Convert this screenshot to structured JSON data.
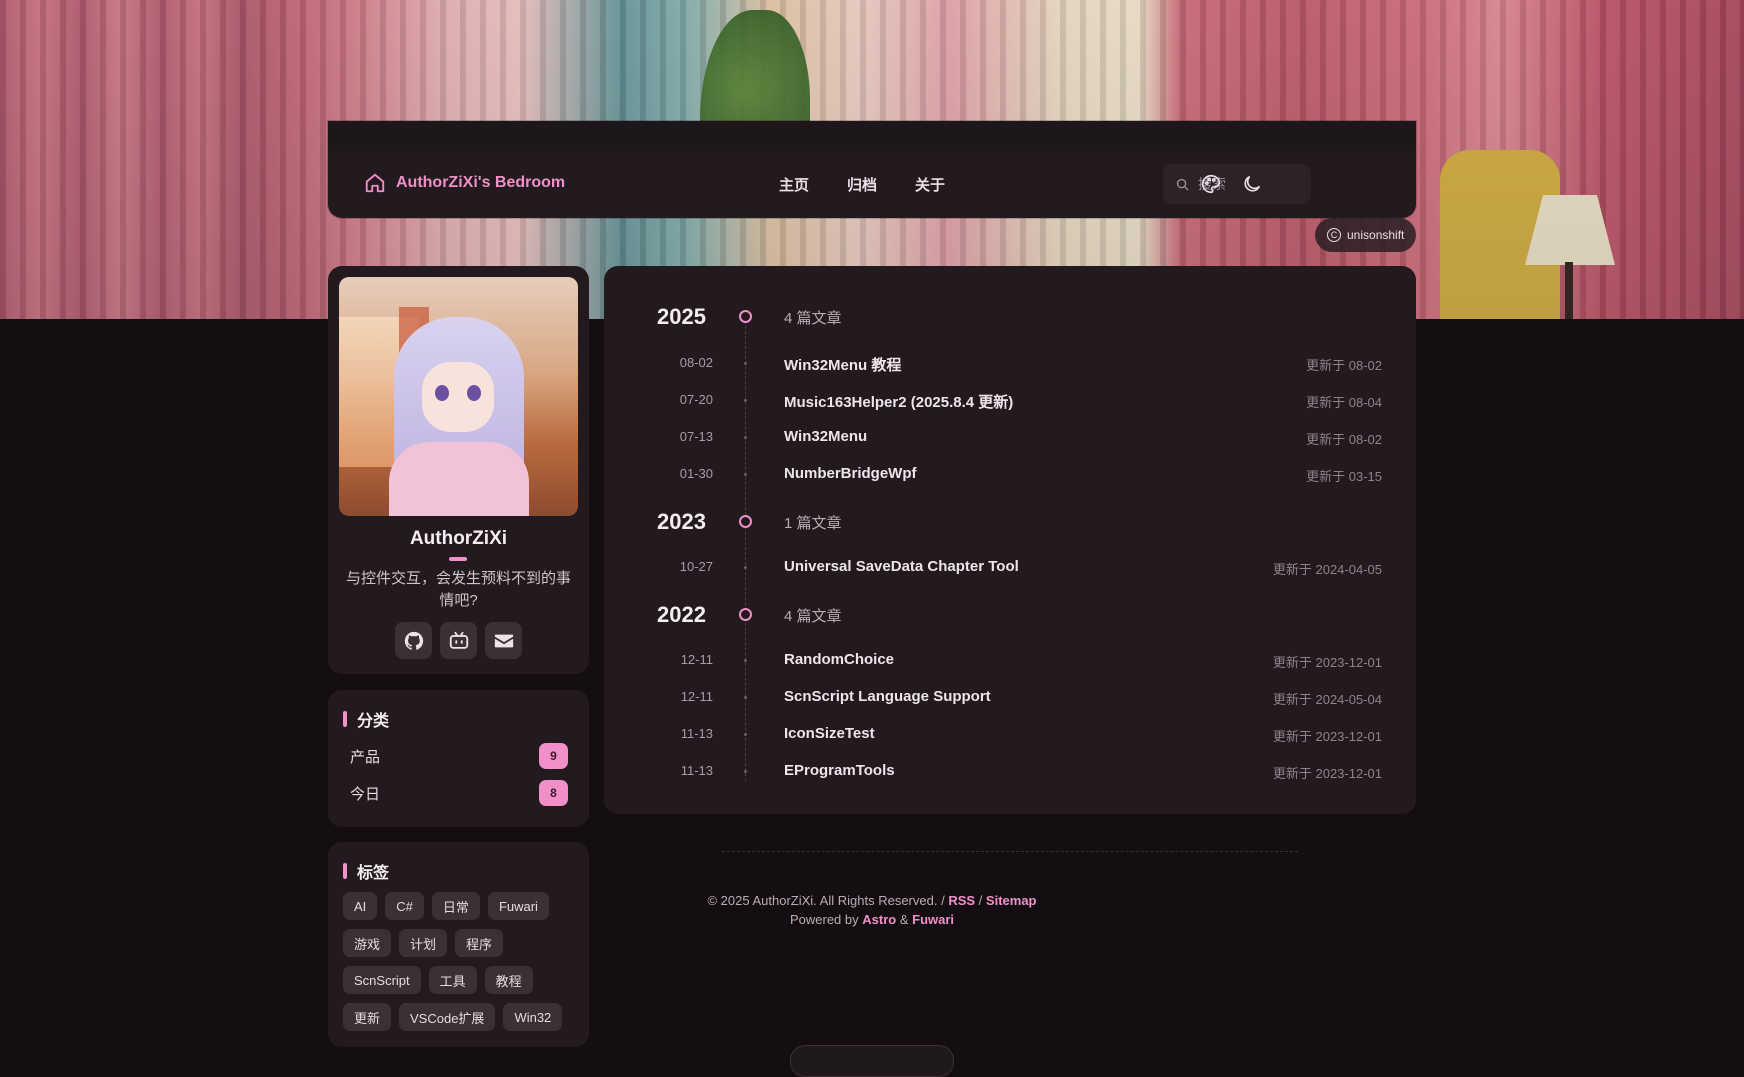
{
  "header": {
    "brand": "AuthorZiXi's Bedroom",
    "menu": [
      "主页",
      "归档",
      "关于"
    ],
    "search_placeholder": "搜索"
  },
  "banner_credit": "unisonshift",
  "profile": {
    "name": "AuthorZiXi",
    "bio": "与控件交互，会发生预料不到的事情吧?",
    "socials": [
      "github-icon",
      "bilibili-icon",
      "email-icon"
    ]
  },
  "categories": {
    "title": "分类",
    "items": [
      {
        "name": "产品",
        "count": "9"
      },
      {
        "name": "今日",
        "count": "8"
      }
    ]
  },
  "tags": {
    "title": "标签",
    "items": [
      "AI",
      "C#",
      "日常",
      "Fuwari",
      "游戏",
      "计划",
      "程序",
      "ScnScript",
      "工具",
      "教程",
      "更新",
      "VSCode扩展",
      "Win32"
    ]
  },
  "archive": [
    {
      "year": "2025",
      "count": "4 篇文章",
      "posts": [
        {
          "date": "08-02",
          "title": "Win32Menu 教程",
          "updated": "更新于 08-02"
        },
        {
          "date": "07-20",
          "title": "Music163Helper2 (2025.8.4 更新)",
          "updated": "更新于 08-04"
        },
        {
          "date": "07-13",
          "title": "Win32Menu",
          "updated": "更新于 08-02"
        },
        {
          "date": "01-30",
          "title": "NumberBridgeWpf",
          "updated": "更新于 03-15"
        }
      ]
    },
    {
      "year": "2023",
      "count": "1 篇文章",
      "posts": [
        {
          "date": "10-27",
          "title": "Universal SaveData Chapter Tool",
          "updated": "更新于 2024-04-05"
        }
      ]
    },
    {
      "year": "2022",
      "count": "4 篇文章",
      "posts": [
        {
          "date": "12-11",
          "title": "RandomChoice",
          "updated": "更新于 2023-12-01"
        },
        {
          "date": "12-11",
          "title": "ScnScript Language Support",
          "updated": "更新于 2024-05-04"
        },
        {
          "date": "11-13",
          "title": "IconSizeTest",
          "updated": "更新于 2023-12-01"
        },
        {
          "date": "11-13",
          "title": "EProgramTools",
          "updated": "更新于 2023-12-01"
        }
      ]
    }
  ],
  "footer": {
    "copyright": "© 2025 AuthorZiXi. All Rights Reserved. /",
    "rss": "RSS",
    "sep1": "/",
    "sitemap": "Sitemap",
    "powered": "Powered by",
    "astro": "Astro",
    "amp": "&",
    "fuwari": "Fuwari"
  },
  "colors": {
    "accent": "#f08fc8",
    "background": "#140e12",
    "card": "#221a1f"
  }
}
